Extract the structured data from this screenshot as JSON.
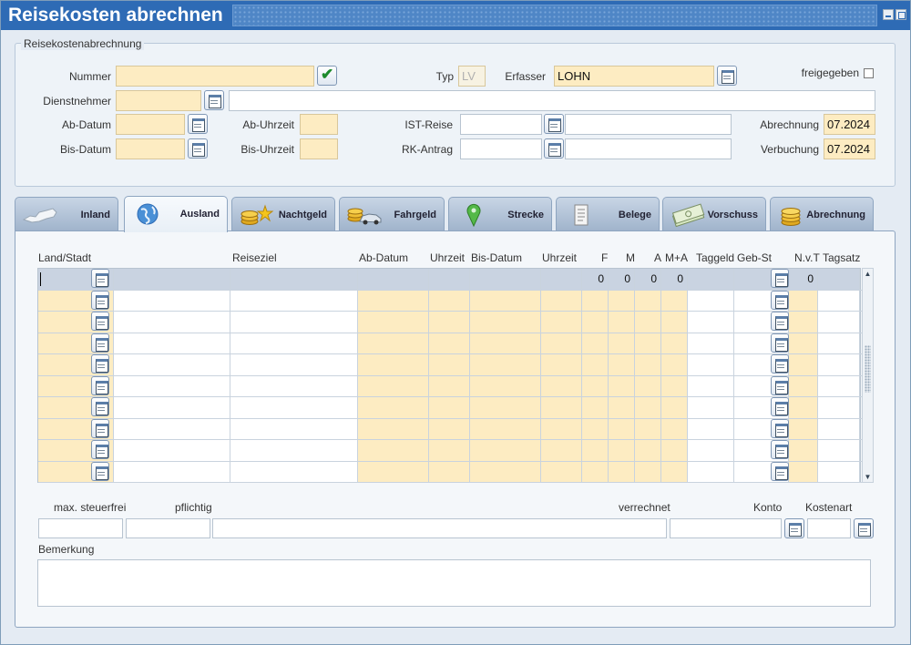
{
  "window": {
    "title": "Reisekosten abrechnen"
  },
  "header": {
    "group_label": "Reisekostenabrechnung",
    "nummer_label": "Nummer",
    "nummer_value": "",
    "typ_label": "Typ",
    "typ_value": "LV",
    "erfasser_label": "Erfasser",
    "erfasser_value": "LOHN",
    "freigegeben_label": "freigegeben",
    "dienstnehmer_label": "Dienstnehmer",
    "ab_datum_label": "Ab-Datum",
    "ab_uhrzeit_label": "Ab-Uhrzeit",
    "ist_reise_label": "IST-Reise",
    "abrechnung_label": "Abrechnung",
    "abrechnung_value": "07.2024",
    "bis_datum_label": "Bis-Datum",
    "bis_uhrzeit_label": "Bis-Uhrzeit",
    "rk_antrag_label": "RK-Antrag",
    "verbuchung_label": "Verbuchung",
    "verbuchung_value": "07.2024"
  },
  "tabs": [
    {
      "label": "Inland",
      "icon": "austria-map-icon"
    },
    {
      "label": "Ausland",
      "icon": "globe-icon"
    },
    {
      "label": "Nachtgeld",
      "icon": "coins-stars-icon"
    },
    {
      "label": "Fahrgeld",
      "icon": "coins-car-icon"
    },
    {
      "label": "Strecke",
      "icon": "map-pin-icon"
    },
    {
      "label": "Belege",
      "icon": "receipt-icon"
    },
    {
      "label": "Vorschuss",
      "icon": "banknotes-icon"
    },
    {
      "label": "Abrechnung",
      "icon": "coins-icon"
    }
  ],
  "active_tab": "Ausland",
  "grid": {
    "headers": {
      "land_stadt": "Land/Stadt",
      "reiseziel": "Reiseziel",
      "ab_datum": "Ab-Datum",
      "uhrzeit1": "Uhrzeit",
      "bis_datum": "Bis-Datum",
      "uhrzeit2": "Uhrzeit",
      "f": "F",
      "m": "M",
      "a": "A",
      "ma": "M+A",
      "taggeld": "Taggeld",
      "geb_st": "Geb-St",
      "nvt": "N.v.T",
      "tagsatz": "Tagsatz"
    },
    "first_row": {
      "f": "0",
      "m": "0",
      "a": "0",
      "ma": "0",
      "nvt": "0"
    },
    "row_count": 10
  },
  "footer": {
    "max_steuerfrei_label": "max. steuerfrei",
    "pflichtig_label": "pflichtig",
    "verrechnet_label": "verrechnet",
    "konto_label": "Konto",
    "kostenart_label": "Kostenart",
    "bemerkung_label": "Bemerkung"
  },
  "colors": {
    "title_bar": "#2e6bb5",
    "required_field": "#fdecc2",
    "selected_row": "#c9d3e1"
  }
}
